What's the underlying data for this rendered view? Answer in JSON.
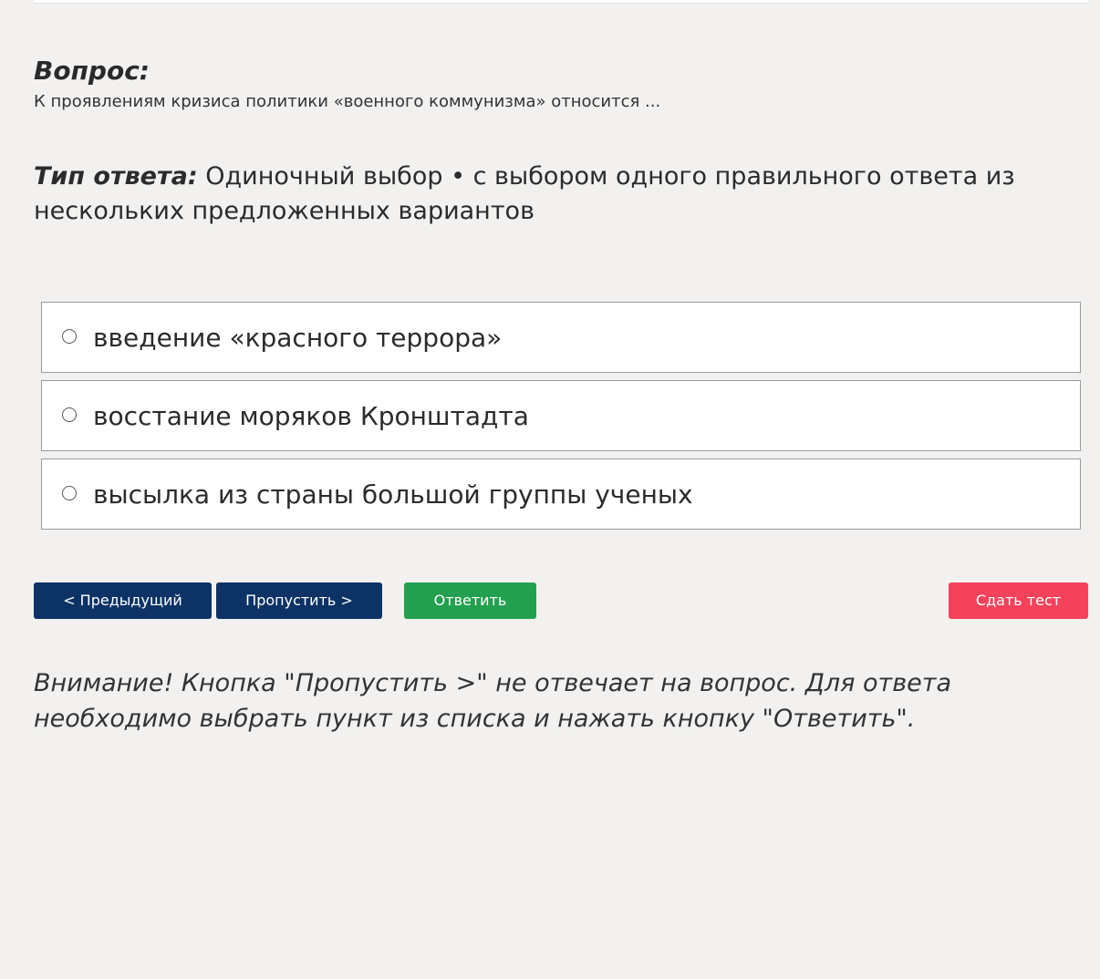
{
  "question": {
    "heading": "Вопрос:",
    "text": "К проявлениям кризиса политики «военного коммунизма» относится ..."
  },
  "answer_type": {
    "label": "Тип ответа:",
    "value": "Одиночный выбор • с выбором одного правильного ответа из нескольких предложенных вариантов"
  },
  "options": [
    {
      "label": "введение «красного террора»",
      "selected": false
    },
    {
      "label": "восстание моряков Кронштадта",
      "selected": false
    },
    {
      "label": "высылка из страны большой группы ученых",
      "selected": false
    }
  ],
  "buttons": {
    "prev": "< Предыдущий",
    "skip": "Пропустить >",
    "answer": "Ответить",
    "submit": "Сдать тест"
  },
  "warning": "Внимание! Кнопка \"Пропустить >\" не отвечает на вопрос. Для ответа необходимо выбрать пункт из списка и нажать кнопку \"Ответить\".",
  "colors": {
    "background": "#f2f1ef",
    "nav_button": "#0d3366",
    "answer_button": "#23a04f",
    "submit_button": "#f4425a"
  }
}
